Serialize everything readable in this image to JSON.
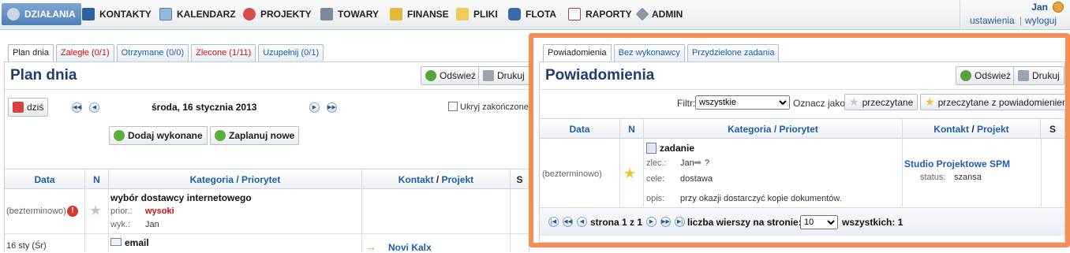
{
  "nav": {
    "items": [
      {
        "label": "DZIAŁANIA",
        "icon": "gear-icon",
        "active": true
      },
      {
        "label": "KONTAKTY",
        "icon": "contacts-book-icon"
      },
      {
        "label": "KALENDARZ",
        "icon": "calendar-icon"
      },
      {
        "label": "PROJEKTY",
        "icon": "projects-icon"
      },
      {
        "label": "TOWARY",
        "icon": "cart-icon"
      },
      {
        "label": "FINANSE",
        "icon": "money-icon"
      },
      {
        "label": "PLIKI",
        "icon": "folder-icon"
      },
      {
        "label": "FLOTA",
        "icon": "car-icon"
      },
      {
        "label": "RAPORTY",
        "icon": "report-icon"
      },
      {
        "label": "ADMIN",
        "icon": "wrench-icon"
      }
    ],
    "user": {
      "name": "Jan",
      "settings": "ustawienia",
      "logout": "wyloguj"
    }
  },
  "left": {
    "tabs": [
      "Plan dnia",
      "Zaległe (0/1)",
      "Otrzymane (0/0)",
      "Zlecone (1/11)",
      "Uzupełnij (0/1)"
    ],
    "title": "Plan dnia",
    "refresh": "Odśwież",
    "print": "Drukuj",
    "today": "dziś",
    "date": "środa, 16 stycznia 2013",
    "hide_done": "Ukryj zakończone",
    "add_done": "Dodaj wykonane",
    "plan_new": "Zaplanuj nowe",
    "columns": {
      "data": "Data",
      "n": "N",
      "category": "Kategoria / Priorytet",
      "contact": "Kontakt",
      "slash": "/",
      "project": "Projekt",
      "s": "S"
    },
    "rows": [
      {
        "date": "(bezterminowo)",
        "title": "wybór dostawcy internetowego",
        "prior_label": "prior.:",
        "prior": "wysoki",
        "wyk_label": "wyk.:",
        "wyk": "Jan"
      },
      {
        "date": "16 sty (Śr)",
        "title": "email",
        "contact": "Novi Kalx"
      }
    ]
  },
  "right": {
    "tabs": [
      "Powiadomienia",
      "Bez wykonawcy",
      "Przydzielone zadania"
    ],
    "title": "Powiadomienia",
    "refresh": "Odśwież",
    "print": "Drukuj",
    "filter_label": "Filtr:",
    "filter_value": "wszystkie",
    "mark_label": "Oznacz jako:",
    "mark_read": "przeczytane",
    "mark_read_notify": "przeczytane z powiadomieniem",
    "columns": {
      "data": "Data",
      "n": "N",
      "category": "Kategoria / Priorytet",
      "contact": "Kontakt",
      "slash": "/",
      "project": "Projekt",
      "s": "S"
    },
    "row": {
      "date": "(bezterminowo)",
      "title": "zadanie",
      "zlec_label": "zlec.:",
      "zlec": "Jan",
      "zlec_q": "?",
      "cele_label": "cele:",
      "cele": "dostawa",
      "opis_label": "opis:",
      "opis": "przy okazji dostarczyć kopie dokumentów.",
      "company": "Studio Projektowe SPM",
      "status_label": "status:",
      "status": "szansa"
    },
    "pager": {
      "page_text": "strona 1 z 1",
      "rows_label": "liczba wierszy na stronie:",
      "rows_value": "10",
      "total": "wszystkich: 1"
    }
  }
}
